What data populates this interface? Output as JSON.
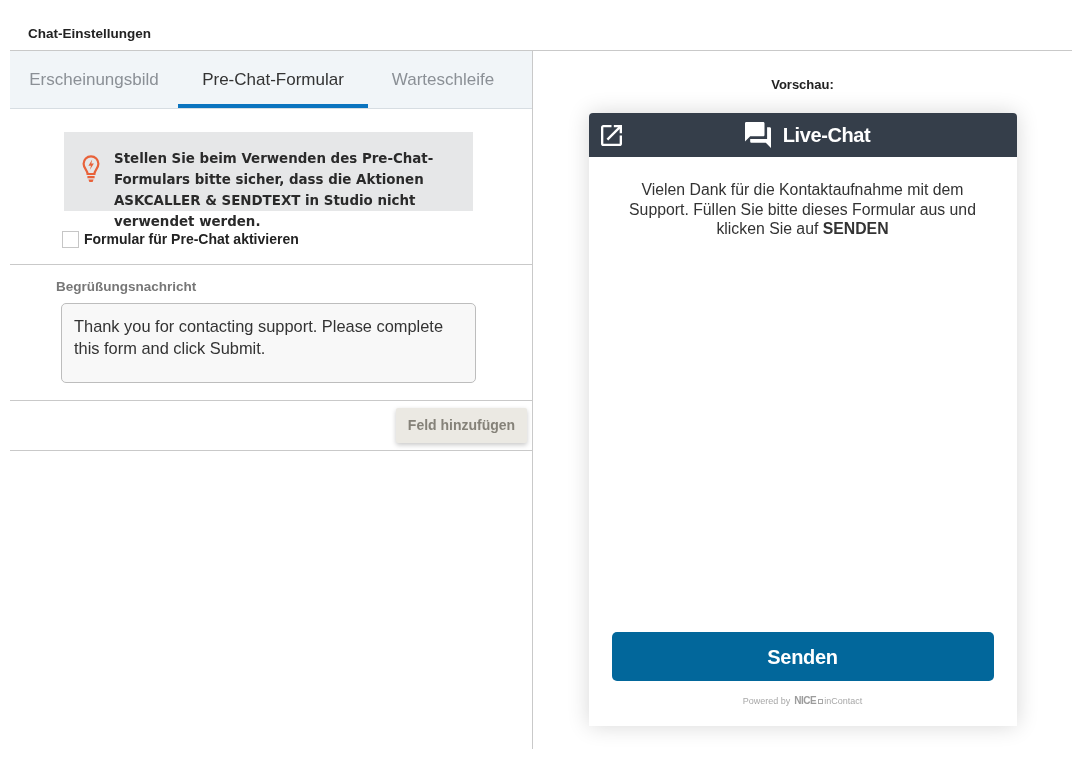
{
  "page_title": "Chat-Einstellungen",
  "tabs": [
    {
      "label": "Erscheinungsbild",
      "selected": false
    },
    {
      "label": "Pre-Chat-Formular",
      "selected": true
    },
    {
      "label": "Warteschleife",
      "selected": false
    }
  ],
  "notice": {
    "text": "Stellen Sie beim Verwenden des Pre-Chat-Formulars bitte sicher, dass die Aktionen ASKCALLER & SENDTEXT in Studio nicht verwendet werden."
  },
  "pre_chat_toggle": {
    "label": "Formular für Pre-Chat aktivieren",
    "checked": false
  },
  "greeting": {
    "label": "Begrüßungsnachricht",
    "value": "Thank you for contacting support. Please complete this form and click Submit."
  },
  "add_field_button": {
    "label": "Feld hinzufügen",
    "disabled": true
  },
  "preview": {
    "label": "Vorschau:",
    "header_title": "Live-Chat",
    "message": "Vielen Dank für die Kontaktaufnahme mit dem Support. Füllen Sie bitte dieses Formular aus und klicken Sie auf **SENDEN**",
    "submit_button": "Senden",
    "footer": {
      "prefix": "Powered by",
      "brand": "NICE",
      "product": "inContact"
    }
  }
}
